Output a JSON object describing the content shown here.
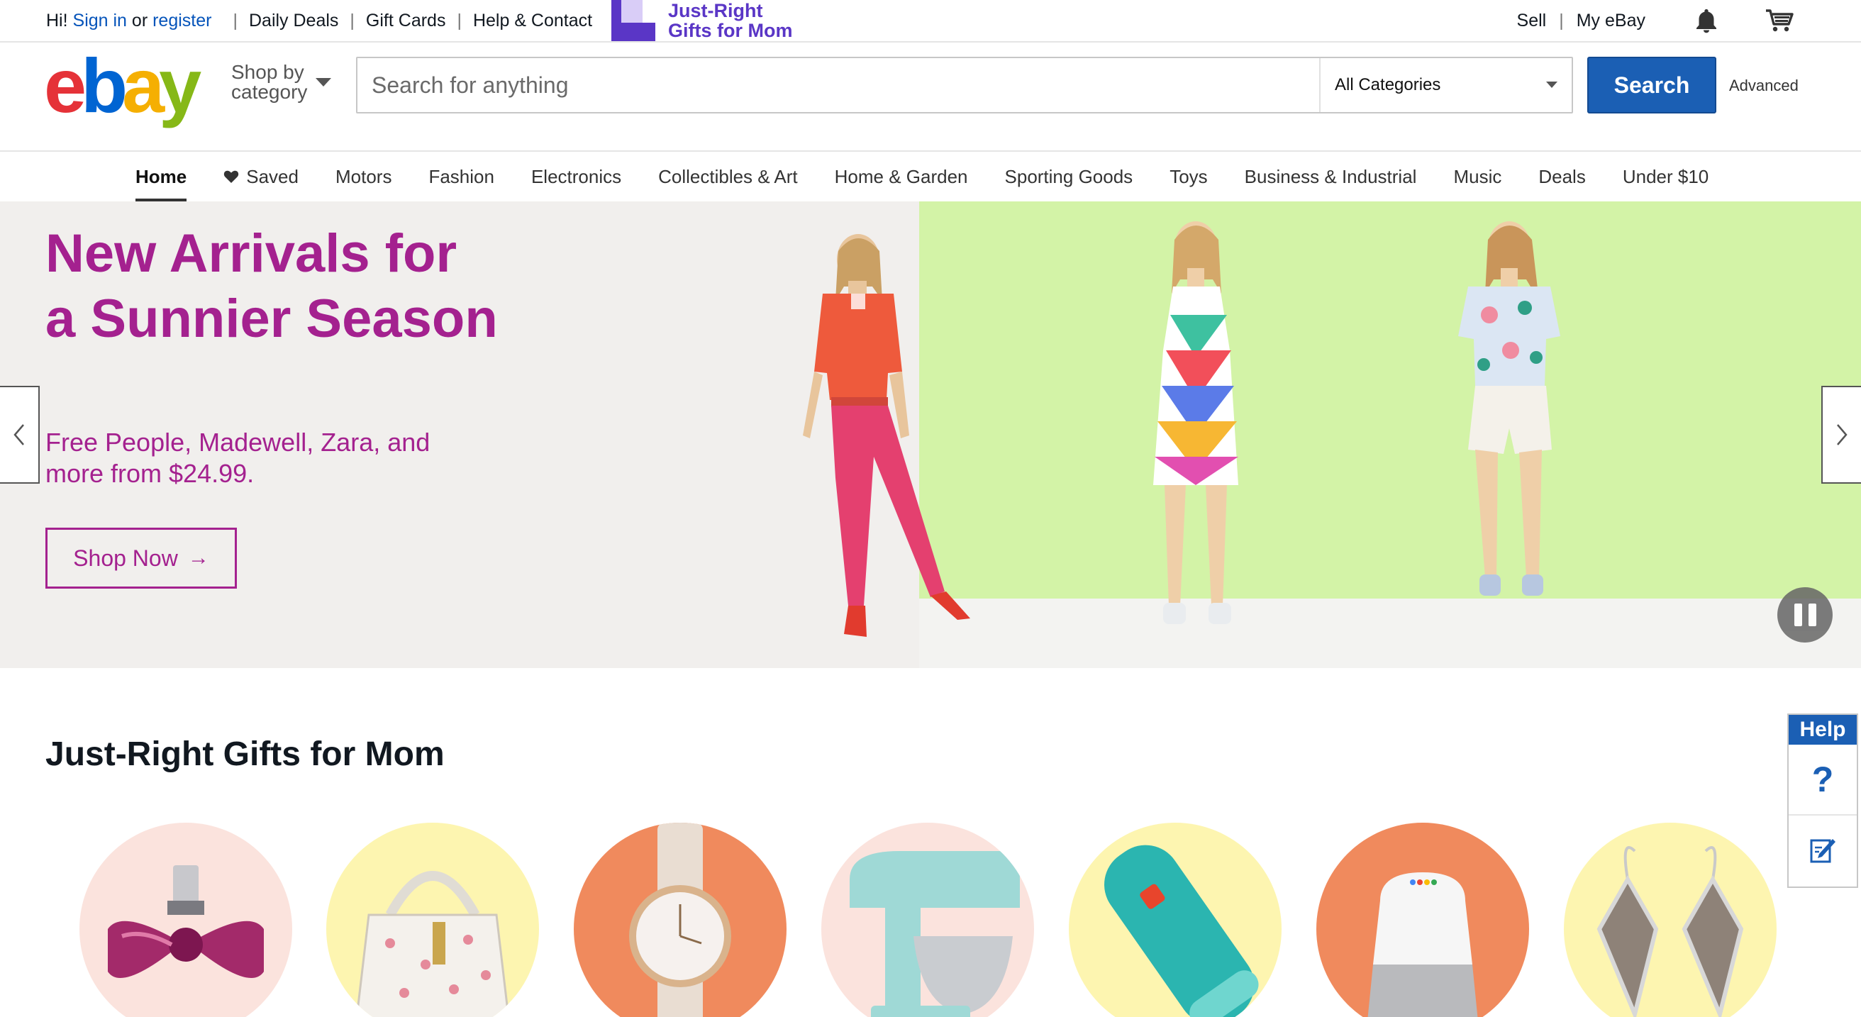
{
  "topbar": {
    "greeting": "Hi!",
    "sign_in": "Sign in",
    "or": "or",
    "register": "register",
    "links": [
      "Daily Deals",
      "Gift Cards",
      "Help & Contact"
    ],
    "promo_line1": "Just-Right",
    "promo_line2": "Gifts for Mom",
    "sell": "Sell",
    "my_ebay": "My eBay",
    "icons": [
      "bell-icon",
      "cart-icon"
    ]
  },
  "header": {
    "logo": [
      "e",
      "b",
      "a",
      "y"
    ],
    "shop_by_line1": "Shop by",
    "shop_by_line2": "category",
    "search_placeholder": "Search for anything",
    "category_selected": "All Categories",
    "search_button": "Search",
    "advanced": "Advanced"
  },
  "nav": {
    "items": [
      "Home",
      "Saved",
      "Motors",
      "Fashion",
      "Electronics",
      "Collectibles & Art",
      "Home & Garden",
      "Sporting Goods",
      "Toys",
      "Business & Industrial",
      "Music",
      "Deals",
      "Under $10"
    ],
    "active": "Home"
  },
  "hero": {
    "title": "New Arrivals for a Sunnier Season",
    "subtitle": "Free People, Madewell, Zara, and more from $24.99.",
    "cta": "Shop Now",
    "cta_arrow": "→"
  },
  "gifts": {
    "title": "Just-Right Gifts for Mom",
    "items": [
      {
        "name": "perfume",
        "bg": "#fbe3dd"
      },
      {
        "name": "handbag",
        "bg": "#fdf5b0"
      },
      {
        "name": "watch",
        "bg": "#f08a5d"
      },
      {
        "name": "stand-mixer",
        "bg": "#fbe3dd"
      },
      {
        "name": "speaker",
        "bg": "#fdf5b0"
      },
      {
        "name": "smart-speaker",
        "bg": "#f08a5d"
      },
      {
        "name": "earrings",
        "bg": "#fdf5b0"
      }
    ]
  },
  "help": {
    "label": "Help",
    "question": "?"
  },
  "colors": {
    "brand_blue": "#1b5fb4",
    "hero_magenta": "#a4218f",
    "hero_green": "#d3f3a7",
    "promo_purple": "#5a36c6"
  }
}
